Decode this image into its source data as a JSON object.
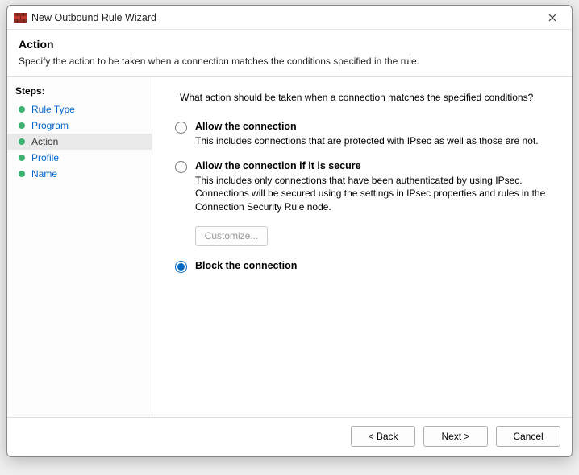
{
  "window": {
    "title": "New Outbound Rule Wizard"
  },
  "header": {
    "heading": "Action",
    "subtext": "Specify the action to be taken when a connection matches the conditions specified in the rule."
  },
  "sidebar": {
    "steps_label": "Steps:",
    "items": [
      {
        "label": "Rule Type",
        "active": false
      },
      {
        "label": "Program",
        "active": false
      },
      {
        "label": "Action",
        "active": true
      },
      {
        "label": "Profile",
        "active": false
      },
      {
        "label": "Name",
        "active": false
      }
    ]
  },
  "main": {
    "prompt": "What action should be taken when a connection matches the specified conditions?",
    "options": [
      {
        "id": "allow",
        "title": "Allow the connection",
        "desc": "This includes connections that are protected with IPsec as well as those are not.",
        "checked": false
      },
      {
        "id": "allow-secure",
        "title": "Allow the connection if it is secure",
        "desc": "This includes only connections that have been authenticated by using IPsec. Connections will be secured using the settings in IPsec properties and rules in the Connection Security Rule node.",
        "checked": false
      },
      {
        "id": "block",
        "title": "Block the connection",
        "desc": "",
        "checked": true
      }
    ],
    "customize_label": "Customize..."
  },
  "footer": {
    "back": "< Back",
    "next": "Next >",
    "cancel": "Cancel"
  }
}
